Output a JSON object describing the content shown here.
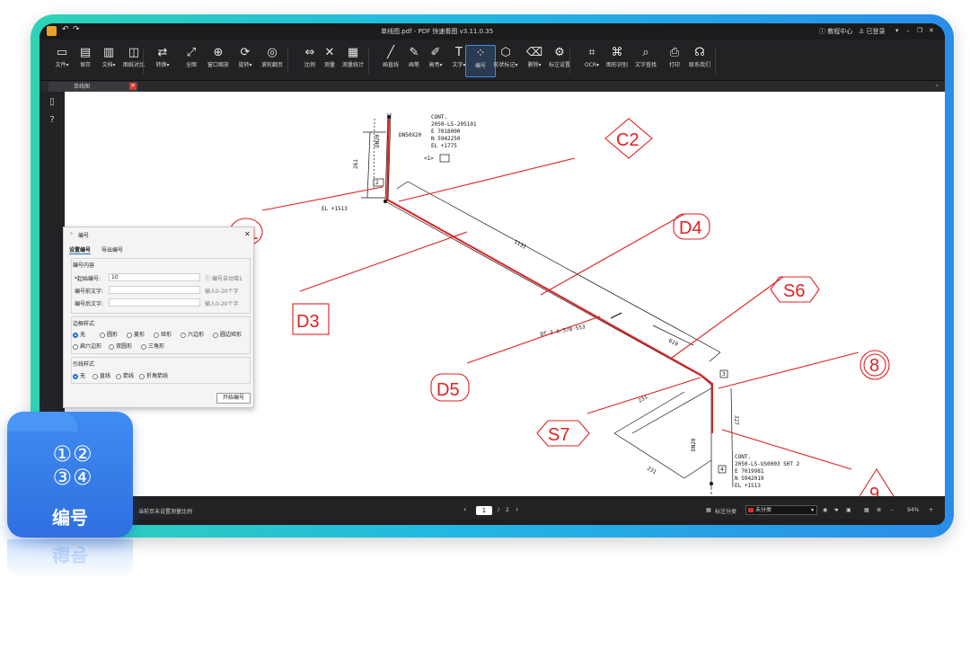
{
  "titlebar": {
    "title": "单线图.pdf - PDF 快速看图 v3.11.0.35",
    "help": "教程中心",
    "login": "已登录"
  },
  "toolbar": {
    "tools": [
      {
        "label": "文件▾",
        "icon": "folder-icon",
        "glyph": "▭"
      },
      {
        "label": "保存",
        "icon": "save-icon",
        "glyph": "▤"
      },
      {
        "label": "文档▾",
        "icon": "document-icon",
        "glyph": "▥"
      },
      {
        "label": "图纸对比",
        "icon": "compare-icon",
        "glyph": "◫"
      },
      {
        "label": "转换▾",
        "icon": "convert-icon",
        "glyph": "⇄"
      },
      {
        "label": "全图",
        "icon": "fit-all-icon",
        "glyph": "⤢"
      },
      {
        "label": "窗口缩放",
        "icon": "zoom-window-icon",
        "glyph": "⊕"
      },
      {
        "label": "旋转▾",
        "icon": "rotate-icon",
        "glyph": "⟳"
      },
      {
        "label": "滚轮翻页",
        "icon": "scroll-page-icon",
        "glyph": "◎"
      },
      {
        "label": "比例",
        "icon": "scale-icon",
        "glyph": "⇔"
      },
      {
        "label": "测量",
        "icon": "measure-icon",
        "glyph": "✕"
      },
      {
        "label": "测量统计",
        "icon": "measure-stats-icon",
        "glyph": "▦"
      },
      {
        "label": "画直线",
        "icon": "line-icon",
        "glyph": "╱"
      },
      {
        "label": "画笔",
        "icon": "pen-icon",
        "glyph": "✎"
      },
      {
        "label": "高亮▾",
        "icon": "highlight-icon",
        "glyph": "✐"
      },
      {
        "label": "文字▾",
        "icon": "text-icon",
        "glyph": "T"
      },
      {
        "label": "编号",
        "icon": "numbering-icon",
        "glyph": "⁘"
      },
      {
        "label": "形状标记▾",
        "icon": "shape-mark-icon",
        "glyph": "⬡"
      },
      {
        "label": "删除▾",
        "icon": "eraser-icon",
        "glyph": "⌫"
      },
      {
        "label": "标注设置",
        "icon": "annotation-settings-icon",
        "glyph": "⚙"
      },
      {
        "label": "OCR▾",
        "icon": "ocr-icon",
        "glyph": "⌗"
      },
      {
        "label": "图形识别",
        "icon": "shape-recognize-icon",
        "glyph": "⌘"
      },
      {
        "label": "文字查找",
        "icon": "search-icon",
        "glyph": "⌕"
      },
      {
        "label": "打印",
        "icon": "print-icon",
        "glyph": "⎙"
      },
      {
        "label": "联系我们",
        "icon": "headset-icon",
        "glyph": "☊"
      }
    ]
  },
  "tab": {
    "name": "单线图"
  },
  "drawing": {
    "cont_top": [
      "CONT.",
      "2050-LS-205101",
      "E 7018000",
      "N 5942250",
      "EL +1775"
    ],
    "cont_bottom": [
      "CONT.",
      "2050-LS-US0003 SHT 2",
      "E 7019981",
      "N 5942019",
      "EL +1513"
    ],
    "el_left": "EL +1513",
    "dn_top": "DN50X20",
    "dim_vertical": "261",
    "dim_main": "1131",
    "dim_619": "619",
    "dim_231a": "231",
    "dim_231b": "231",
    "dim_327": "327",
    "dim_dn20": "DN20",
    "line_ref": "DT-3-A-578-553",
    "box_1": "<1>",
    "box_2": "2",
    "box_3": "3",
    "box_4": "4",
    "callouts": {
      "c1": "C1",
      "c2": "C2",
      "d3": "D3",
      "d4": "D4",
      "d5": "D5",
      "s6": "S6",
      "s7": "S7",
      "n8": "8",
      "n9": "9"
    }
  },
  "dialog": {
    "title": "编号",
    "tabs": [
      "设置编号",
      "导出编号"
    ],
    "section_content": "编号内容",
    "start_label": "*起始编号:",
    "start_value": "10",
    "start_hint": "编号自动增1",
    "prefix_label": "编号前文字:",
    "prefix_hint": "输入0-20个字",
    "suffix_label": "编号后文字:",
    "suffix_hint": "输入0-20个字",
    "border_title": "边框样式",
    "border_options": [
      "无",
      "圆形",
      "菱形",
      "矩形",
      "六边形",
      "圆边矩形",
      "扁六边形",
      "双圆形",
      "三角形"
    ],
    "leader_title": "引线样式",
    "leader_options": [
      "无",
      "直线",
      "箭线",
      "折角箭线"
    ],
    "start_button": "开始编号"
  },
  "status": {
    "scale_note": "当前页未设置测量比例",
    "page_current": "1",
    "page_sep": "/",
    "page_total": "2",
    "category_label": "标注分类",
    "category_value": "未分类",
    "zoom": "94%"
  },
  "badge": {
    "numbers": "①②\n③④",
    "label": "编号"
  },
  "colors": {
    "accent": "#1e6fd8",
    "markup_red": "#e02020",
    "frame_teal": "#2fd3b6",
    "frame_blue": "#2a8de8"
  }
}
